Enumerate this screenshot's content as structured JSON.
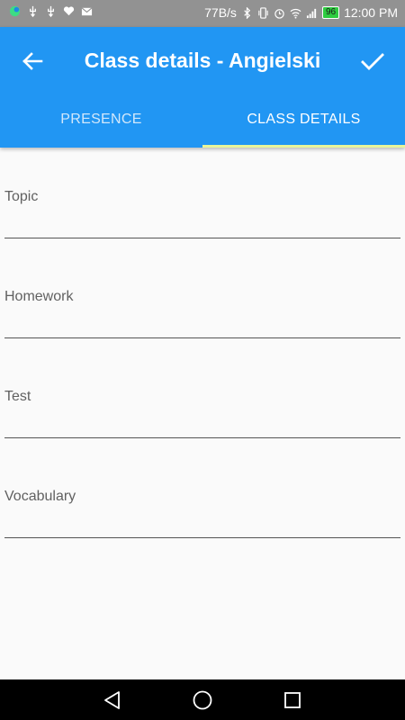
{
  "status_bar": {
    "speed": "77B/s",
    "battery": "96",
    "time": "12:00 PM"
  },
  "app_bar": {
    "title": "Class details - Angielski",
    "back_icon": "arrow-back-icon",
    "confirm_icon": "check-icon"
  },
  "tabs": [
    {
      "label": "PRESENCE",
      "active": false
    },
    {
      "label": "CLASS DETAILS",
      "active": true
    }
  ],
  "form": {
    "fields": [
      {
        "label": "Topic",
        "value": ""
      },
      {
        "label": "Homework",
        "value": ""
      },
      {
        "label": "Test",
        "value": ""
      },
      {
        "label": "Vocabulary",
        "value": ""
      }
    ]
  },
  "colors": {
    "primary": "#2196f3",
    "tab_indicator": "#e8f59a",
    "status_bar": "#929292",
    "background": "#fafafa"
  }
}
